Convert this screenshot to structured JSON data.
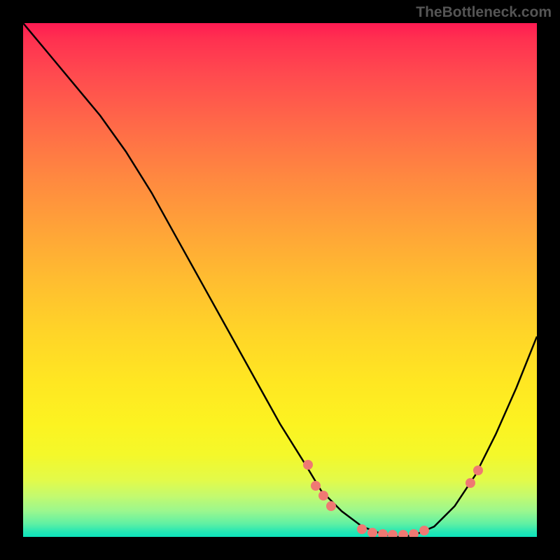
{
  "watermark": "TheBottleneck.com",
  "chart_data": {
    "type": "line",
    "title": "",
    "xlabel": "",
    "ylabel": "",
    "xlim": [
      0,
      100
    ],
    "ylim": [
      0,
      100
    ],
    "background_gradient": {
      "orientation": "vertical",
      "stops": [
        {
          "pos": 0,
          "color": "#ff1a52"
        },
        {
          "pos": 50,
          "color": "#ffbd30"
        },
        {
          "pos": 85,
          "color": "#e8f93a"
        },
        {
          "pos": 100,
          "color": "#0ce3bb"
        }
      ]
    },
    "series": [
      {
        "name": "bottleneck-curve",
        "color": "#000000",
        "x": [
          0,
          5,
          10,
          15,
          20,
          25,
          30,
          35,
          40,
          45,
          50,
          55,
          58,
          62,
          66,
          70,
          73,
          76,
          80,
          84,
          88,
          92,
          96,
          100
        ],
        "y": [
          100,
          94,
          88,
          82,
          75,
          67,
          58,
          49,
          40,
          31,
          22,
          14,
          9,
          5,
          2,
          0.5,
          0,
          0.3,
          2,
          6,
          12,
          20,
          29,
          39
        ]
      }
    ],
    "marker_clusters": [
      {
        "cx": 55.5,
        "cy": 14,
        "notes": "pink dots on left slope upper"
      },
      {
        "cx": 57,
        "cy": 10,
        "notes": "pink dots on left slope"
      },
      {
        "cx": 58.5,
        "cy": 8,
        "notes": "pink dots on left slope"
      },
      {
        "cx": 60,
        "cy": 6,
        "notes": "pink dots on left slope lower"
      },
      {
        "cx": 66,
        "cy": 1.5,
        "notes": "trough cluster"
      },
      {
        "cx": 68,
        "cy": 0.8,
        "notes": "trough cluster"
      },
      {
        "cx": 70,
        "cy": 0.5,
        "notes": "trough cluster"
      },
      {
        "cx": 72,
        "cy": 0.4,
        "notes": "trough cluster"
      },
      {
        "cx": 74,
        "cy": 0.4,
        "notes": "trough cluster"
      },
      {
        "cx": 76,
        "cy": 0.5,
        "notes": "trough cluster"
      },
      {
        "cx": 78,
        "cy": 1.2,
        "notes": "trough cluster right"
      },
      {
        "cx": 87,
        "cy": 10.5,
        "notes": "right slope dots"
      },
      {
        "cx": 88.5,
        "cy": 13,
        "notes": "right slope dots"
      }
    ],
    "marker_color": "#ef7973"
  }
}
